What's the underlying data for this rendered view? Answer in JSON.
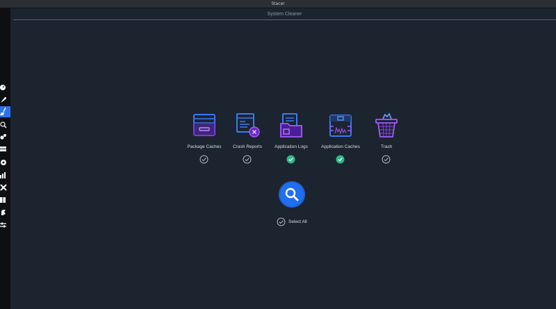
{
  "window": {
    "title": "Stacer"
  },
  "page": {
    "title": "System Cleaner"
  },
  "sidebar": {
    "items": [
      {
        "name": "dashboard",
        "icon": "dashboard-icon",
        "active": false
      },
      {
        "name": "startup-apps",
        "icon": "rocket-icon",
        "active": false
      },
      {
        "name": "system-cleaner",
        "icon": "broom-icon",
        "active": true
      },
      {
        "name": "search",
        "icon": "search-icon",
        "active": false
      },
      {
        "name": "services",
        "icon": "gears-icon",
        "active": false
      },
      {
        "name": "processes",
        "icon": "processes-icon",
        "active": false
      },
      {
        "name": "uninstaller",
        "icon": "package-icon",
        "active": false
      },
      {
        "name": "resources",
        "icon": "chart-icon",
        "active": false
      },
      {
        "name": "helpers",
        "icon": "tools-icon",
        "active": false
      },
      {
        "name": "apt-repository",
        "icon": "box-icon",
        "active": false
      },
      {
        "name": "gnome-settings",
        "icon": "gnome-icon",
        "active": false
      },
      {
        "name": "settings",
        "icon": "sliders-icon",
        "active": false
      }
    ]
  },
  "cleaner": {
    "categories": [
      {
        "label": "Package Caches",
        "icon": "package-caches-icon",
        "checked": false
      },
      {
        "label": "Crash Reports",
        "icon": "crash-reports-icon",
        "checked": false
      },
      {
        "label": "Application Logs",
        "icon": "application-logs-icon",
        "checked": true
      },
      {
        "label": "Application Caches",
        "icon": "application-caches-icon",
        "checked": true
      },
      {
        "label": "Trash",
        "icon": "trash-icon",
        "checked": false
      }
    ],
    "select_all_label": "Select All",
    "select_all_checked": false
  },
  "colors": {
    "background": "#1c2430",
    "accent_blue": "#1f6ff2",
    "check_green": "#2eb886",
    "icon_purple": "#8e3bf0",
    "icon_blue": "#3a7bf6"
  }
}
